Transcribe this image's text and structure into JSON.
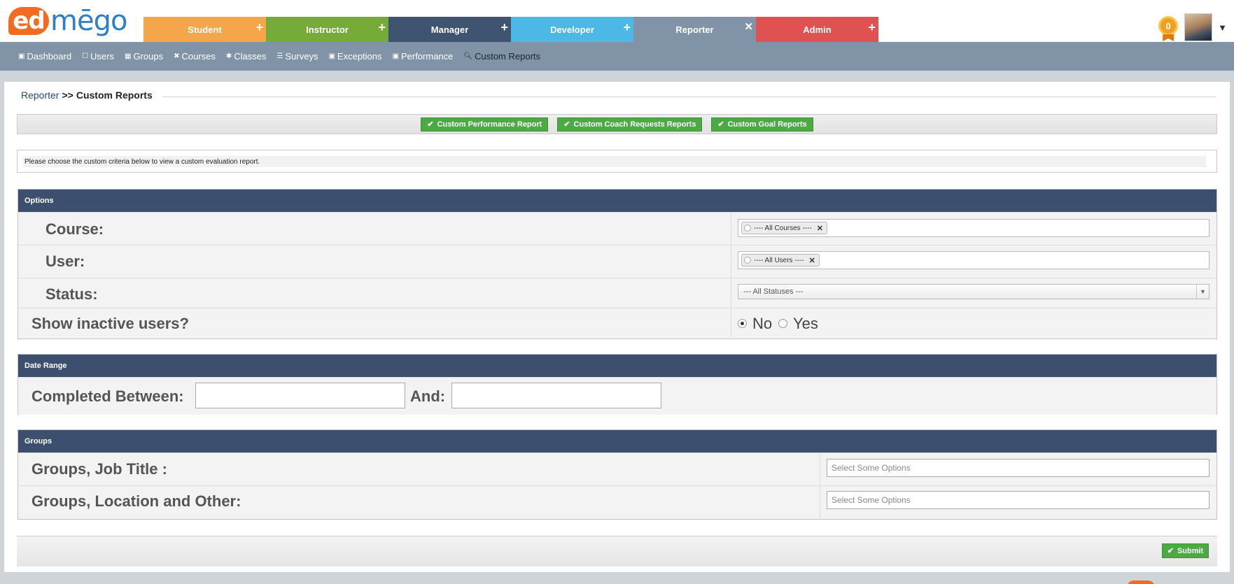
{
  "logo": {
    "part1": "ed",
    "part2": "mēgo"
  },
  "roles": [
    {
      "label": "Student",
      "color": "#f5a54a",
      "icon": "plus-icon",
      "symbol": "+"
    },
    {
      "label": "Instructor",
      "color": "#76ab3a",
      "icon": "plus-icon",
      "symbol": "+"
    },
    {
      "label": "Manager",
      "color": "#3f5470",
      "icon": "plus-icon",
      "symbol": "+"
    },
    {
      "label": "Developer",
      "color": "#4cb8e6",
      "icon": "plus-icon",
      "symbol": "+"
    },
    {
      "label": "Reporter",
      "color": "#8193a6",
      "icon": "close-icon",
      "symbol": "✕"
    },
    {
      "label": "Admin",
      "color": "#e05252",
      "icon": "plus-icon",
      "symbol": "+"
    }
  ],
  "user": {
    "badge_count": "0",
    "menu_caret": "▼"
  },
  "nav": [
    {
      "label": "Dashboard",
      "icon": "dashboard-icon",
      "glyph": "▣"
    },
    {
      "label": "Users",
      "icon": "user-icon",
      "glyph": "☐"
    },
    {
      "label": "Groups",
      "icon": "groups-icon",
      "glyph": "▦"
    },
    {
      "label": "Courses",
      "icon": "courses-icon",
      "glyph": "✖"
    },
    {
      "label": "Classes",
      "icon": "classes-icon",
      "glyph": "✱"
    },
    {
      "label": "Surveys",
      "icon": "surveys-icon",
      "glyph": "☰"
    },
    {
      "label": "Exceptions",
      "icon": "exceptions-icon",
      "glyph": "▣"
    },
    {
      "label": "Performance",
      "icon": "performance-icon",
      "glyph": "▣"
    },
    {
      "label": "Custom Reports",
      "icon": "search-icon",
      "glyph": "🔍︎"
    }
  ],
  "breadcrumb": {
    "parent": "Reporter",
    "separator": ">>",
    "current": "Custom Reports"
  },
  "report_buttons": [
    {
      "label": "Custom Performance Report"
    },
    {
      "label": "Custom Coach Requests Reports"
    },
    {
      "label": "Custom Goal Reports"
    }
  ],
  "check_glyph": "✔",
  "info_text": "Please choose the custom criteria below to view a custom evaluation report.",
  "options": {
    "title": "Options",
    "course_label": "Course:",
    "course_tag": "---- All Courses ----",
    "user_label": "User:",
    "user_tag": "---- All Users ----",
    "status_label": "Status:",
    "status_value": "--- All Statuses ---",
    "inactive_label": "Show inactive users?",
    "inactive_no": "No",
    "inactive_yes": "Yes",
    "inactive_selected": "No",
    "tag_remove": "✕",
    "select_arrow": "▼"
  },
  "date_range": {
    "title": "Date Range",
    "completed_label": "Completed Between:",
    "and_label": "And:",
    "start_value": "",
    "end_value": ""
  },
  "groups": {
    "title": "Groups",
    "job_title_label": "Groups, Job Title :",
    "job_title_placeholder": "Select Some Options",
    "location_label": "Groups, Location and Other:",
    "location_placeholder": "Select Some Options"
  },
  "submit": {
    "label": "Submit"
  },
  "colors": {
    "header_navy": "#3c4f6e",
    "button_green": "#4caa45",
    "nav_gray": "#8193a6",
    "brand_orange": "#f26b21",
    "brand_blue": "#2f7fc7"
  }
}
